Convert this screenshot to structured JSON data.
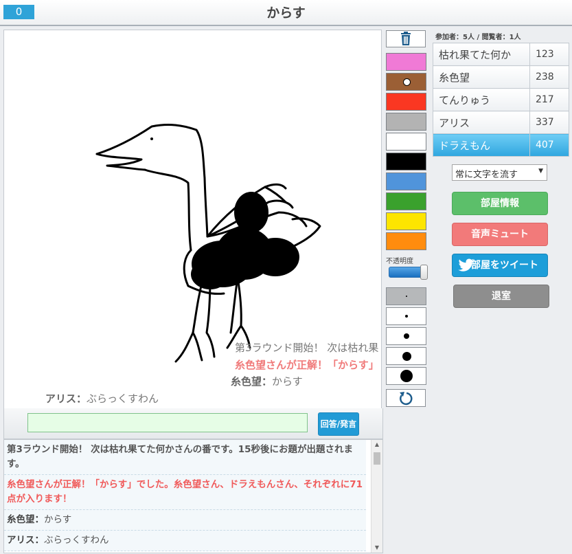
{
  "header": {
    "round_counter": "0",
    "title": "からす"
  },
  "canvas": {
    "overlay_messages": [
      {
        "kind": "system",
        "text": "第3ラウンド開始！ 次は枯れ果"
      },
      {
        "kind": "correct",
        "text": "糸色望さんが正解！「からす」"
      },
      {
        "kind": "chat",
        "name": "糸色望：",
        "text": "からす"
      },
      {
        "kind": "chat",
        "name": "アリス：",
        "text": "ぶらっくすわん"
      }
    ]
  },
  "input": {
    "value": "",
    "submit_label": "回答/発言"
  },
  "chat_log": [
    {
      "kind": "system",
      "text": "第3ラウンド開始！ 次は枯れ果てた何かさんの番です。15秒後にお題が出題されます。"
    },
    {
      "kind": "correct",
      "text": "糸色望さんが正解！「からす」でした。糸色望さん、ドラえもんさん、それぞれに71点が入ります！"
    },
    {
      "kind": "chat",
      "name": "糸色望：",
      "text": "からす"
    },
    {
      "kind": "chat",
      "name": "アリス：",
      "text": "ぶらっくすわん"
    }
  ],
  "tools": {
    "trash_icon": "trash-icon",
    "colors": [
      "#f07ad6",
      "#9b5f35",
      "#fa3722",
      "#b3b3b3",
      "#ffffff",
      "#000000",
      "#5094db",
      "#3aa12d",
      "#fde500",
      "#ff8c0e"
    ],
    "selected_color_index": 1,
    "opacity_label": "不透明度",
    "opacity_value": 1.0,
    "brush_sizes": [
      2,
      4,
      8,
      13,
      18
    ],
    "selected_size_index": 0,
    "undo_icon": "undo-icon"
  },
  "sidebar": {
    "participants_info": "参加者：5人 / 閲覧者：1人",
    "players": [
      {
        "name": "枯れ果てた何か",
        "score": "123"
      },
      {
        "name": "糸色望",
        "score": "238"
      },
      {
        "name": "てんりゅう",
        "score": "217"
      },
      {
        "name": "アリス",
        "score": "337"
      },
      {
        "name": "ドラえもん",
        "score": "407"
      }
    ],
    "active_player_index": 4,
    "scroll_mode": "常に文字を流す",
    "buttons": {
      "room_info": "部屋情報",
      "mute": "音声ミュート",
      "tweet": "部屋をツイート",
      "leave": "退室"
    }
  }
}
